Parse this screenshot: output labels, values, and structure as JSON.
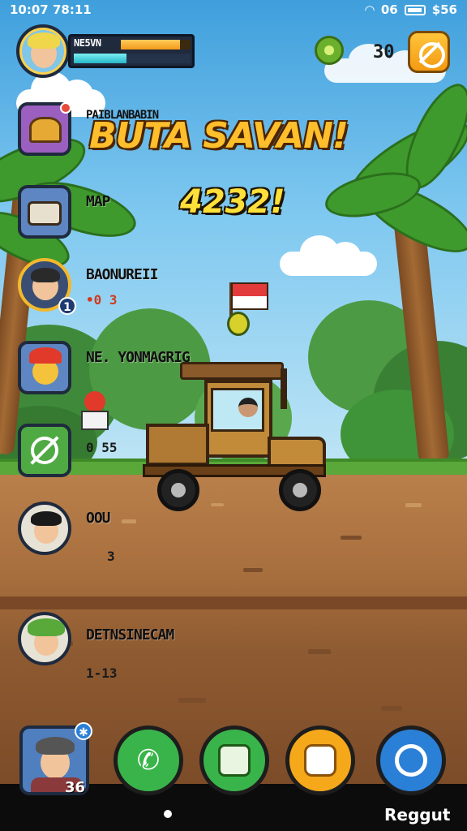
{
  "status_bar": {
    "time": "10:07 78:11",
    "right_text": "$56",
    "mid_text": "06"
  },
  "player": {
    "name": "NE5VN",
    "xp_fraction": 0.85,
    "energy_fraction": 0.45
  },
  "currency": {
    "value": "30"
  },
  "title": {
    "game_name": "BUTA SAVAN!",
    "score": "4232!",
    "subtitle": "PAIBLANBABIN"
  },
  "side_menu": [
    {
      "label": "MAP",
      "sub": ""
    },
    {
      "label": "BAONUREII",
      "sub": "•0 3",
      "badge": "1"
    },
    {
      "label": "NE. YONMAGRIG",
      "sub": ""
    },
    {
      "label": "",
      "sub": "0 55"
    },
    {
      "label": "OOU",
      "sub": "3"
    },
    {
      "label": "DETNSINECAM",
      "sub": "1-13"
    }
  ],
  "dock": {
    "avatar_level": "36",
    "buttons": [
      "phone-button",
      "chat-button",
      "backpack-button",
      "compass-button"
    ],
    "colors": {
      "phone": "#39b44a",
      "chat": "#39b44a",
      "backpack": "#f4a81a",
      "compass": "#2a7fd6"
    }
  },
  "nav": {
    "right_label": "Reggut"
  },
  "colors": {
    "gold": "#ffbe2c",
    "sky": "#5fb7ea",
    "dirt": "#a86f3e"
  }
}
